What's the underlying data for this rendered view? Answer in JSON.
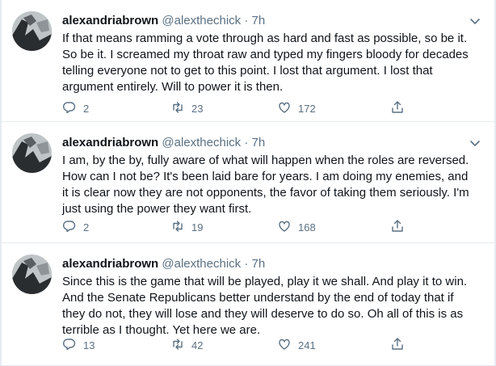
{
  "tweets": [
    {
      "name": "alexandriabrown",
      "handle": "@alexthechick",
      "separator": "·",
      "time": "7h",
      "text": "If that means ramming a vote through as hard and fast as possible, so be it.  So be it.  I screamed my throat raw and typed my fingers bloody for decades telling everyone not to get to this point.  I lost that argument.  I lost that argument entirely.  Will to power it is then.",
      "replies": "2",
      "retweets": "23",
      "likes": "172"
    },
    {
      "name": "alexandriabrown",
      "handle": "@alexthechick",
      "separator": "·",
      "time": "7h",
      "text": "I am, by the by, fully aware of what will happen when the roles are reversed.  How can I not be?  It's been laid bare for years.  I am doing my enemies, and it is clear now they are not opponents, the favor of taking them seriously.  I'm just using the power they want first.",
      "replies": "2",
      "retweets": "19",
      "likes": "168"
    },
    {
      "name": "alexandriabrown",
      "handle": "@alexthechick",
      "separator": "·",
      "time": "7h",
      "text": "Since this is the game that will be played, play it we shall.  And play it to win.  And the Senate Republicans better understand by the end of today that if they do not, they will lose and they will deserve to do so.  Oh all of this is as terrible as I thought.  Yet here we are.",
      "replies": "13",
      "retweets": "42",
      "likes": "241"
    }
  ],
  "icons": {
    "reply": "reply-icon",
    "retweet": "retweet-icon",
    "like": "heart-icon",
    "share": "share-icon",
    "menu": "chevron-down-icon"
  },
  "colors": {
    "text": "#0f1419",
    "secondary": "#5b7083",
    "border": "#e6ecf0"
  }
}
